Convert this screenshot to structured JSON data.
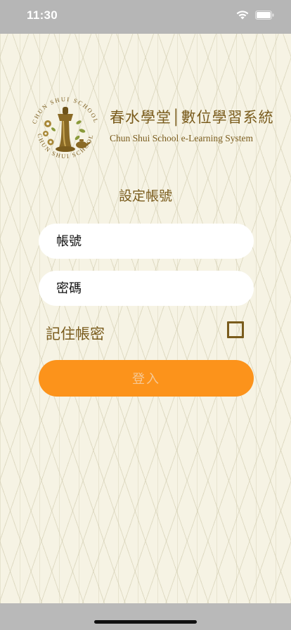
{
  "status_bar": {
    "time": "11:30"
  },
  "brand": {
    "title": "春水學堂│數位學習系統",
    "subtitle": "Chun Shui School e-Learning System",
    "logo_ring_text": "CHUN SHUI SCHOOL"
  },
  "form": {
    "section_title": "設定帳號",
    "username_placeholder": "帳號",
    "password_placeholder": "密碼",
    "remember_label": "記住帳密",
    "remember_checked": false,
    "login_label": "登入"
  },
  "colors": {
    "brand_brown": "#7a5c1d",
    "button_orange": "#fc931b",
    "button_text": "#f6c894",
    "background": "#f6f3e4"
  }
}
